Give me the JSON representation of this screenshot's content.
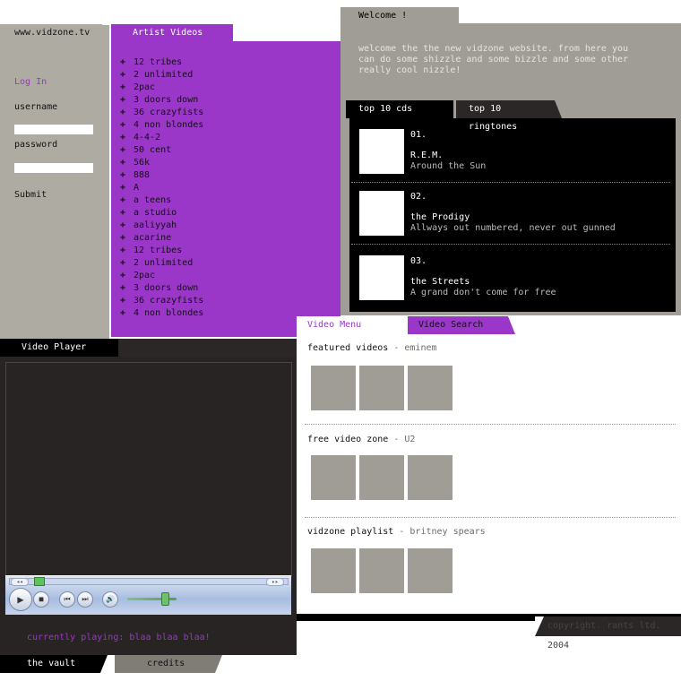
{
  "header": {
    "site_url": "www.vidzone.tv",
    "artist_tab": "Artist Videos",
    "welcome_tab": "Welcome !"
  },
  "login": {
    "title": "Log In",
    "username_label": "username",
    "password_label": "password",
    "submit_label": "Submit"
  },
  "artists": {
    "items": [
      "12 tribes",
      "2 unlimited",
      "2pac",
      "3 doors down",
      "36 crazyfists",
      "4 non blondes",
      "4-4-2",
      "50 cent",
      "56k",
      "888",
      "A",
      "a teens",
      "a studio",
      "aaliyyah",
      "acarine",
      "12 tribes",
      "2 unlimited",
      "2pac",
      "3 doors down",
      "36 crazyfists",
      "4 non blondes"
    ]
  },
  "welcome": {
    "text": "welcome the the new vidzone website. from here you can do some shizzle and some bizzle and some other really cool nizzle!"
  },
  "top10": {
    "tabs": [
      "top 10 cds",
      "top 10 ringtones"
    ],
    "items": [
      {
        "rank": "01.",
        "artist": "R.E.M.",
        "title": "Around the Sun"
      },
      {
        "rank": "02.",
        "artist": "the Prodigy",
        "title": "Allways out numbered, never out gunned"
      },
      {
        "rank": "03.",
        "artist": "the Streets",
        "title": "A grand don't come for free"
      }
    ]
  },
  "video_menu": {
    "tab_menu": "Video Menu",
    "tab_search": "Video Search",
    "sections": [
      {
        "title": "featured videos",
        "subtitle": "- eminem"
      },
      {
        "title": "free video zone",
        "subtitle": "- U2"
      },
      {
        "title": "vidzone playlist",
        "subtitle": "- britney spears"
      }
    ]
  },
  "player": {
    "tab": "Video Player",
    "now_playing": "currently playing: blaa blaa blaa!",
    "icons": [
      "play-icon",
      "stop-icon",
      "previous-icon",
      "next-icon",
      "volume-icon"
    ]
  },
  "footer": {
    "vault_tab": "the vault",
    "credits_tab": "credits",
    "copyright": "copyright. rants ltd. 2004"
  },
  "colors": {
    "purple": "#9a36c8",
    "grey": "#a09d96",
    "dark": "#282424"
  }
}
